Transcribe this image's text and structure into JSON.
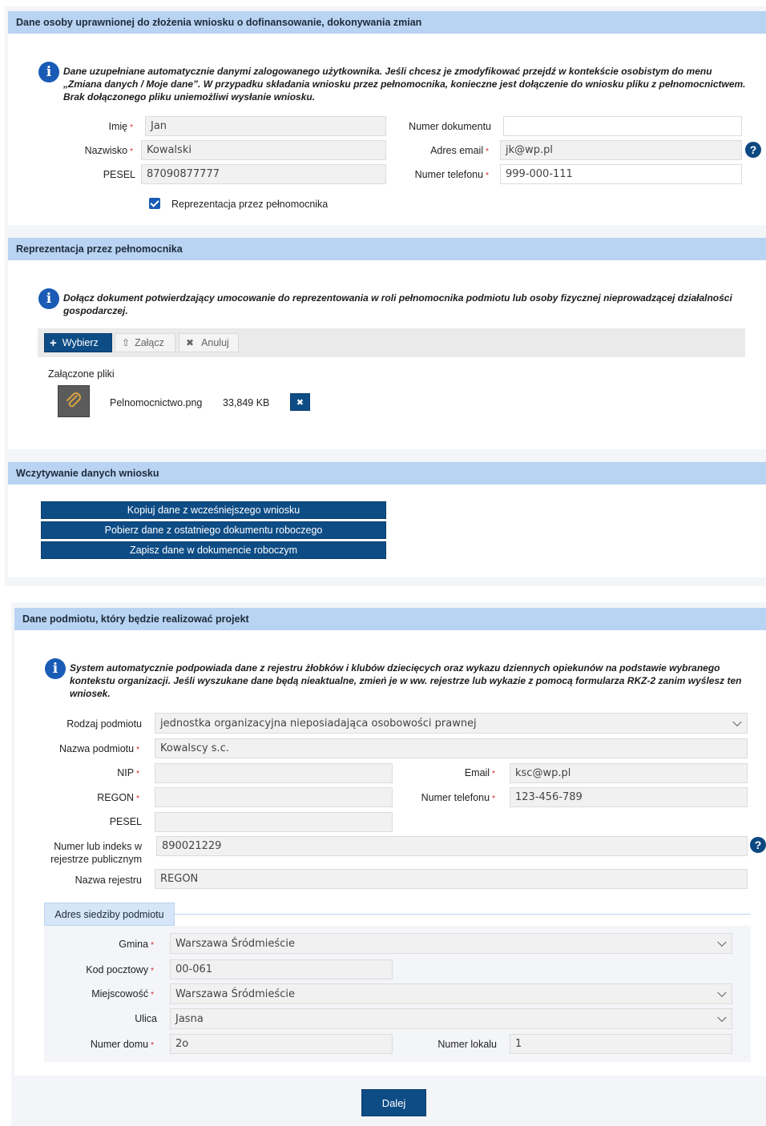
{
  "section1": {
    "title": "Dane osoby uprawnionej do złożenia wniosku o dofinansowanie, dokonywania zmian",
    "info": "Dane uzupełniane automatycznie danymi zalogowanego użytkownika. Jeśli chcesz je zmodyfikować przejdź w kontekście osobistym do menu „Zmiana danych / Moje dane”. W przypadku składania wniosku przez pełnomocnika, konieczne jest dołączenie do wniosku pliku z pełnomocnictwem. Brak dołączonego pliku uniemożliwi wysłanie wniosku.",
    "fields": {
      "imie_label": "Imię",
      "imie_value": "Jan",
      "nazwisko_label": "Nazwisko",
      "nazwisko_value": "Kowalski",
      "pesel_label": "PESEL",
      "pesel_value": "87090877777",
      "numer_dokumentu_label": "Numer dokumentu",
      "numer_dokumentu_value": "",
      "adres_email_label": "Adres email",
      "adres_email_value": "jk@wp.pl",
      "numer_telefonu_label": "Numer telefonu",
      "numer_telefonu_value": "999-000-111"
    },
    "checkbox_label": "Reprezentacja przez pełnomocnika"
  },
  "section2": {
    "title": "Reprezentacja przez pełnomocnika",
    "info": "Dołącz dokument potwierdzający umocowanie do reprezentowania w roli pełnomocnika podmiotu lub osoby fizycznej nieprowadzącej działalności gospodarczej.",
    "buttons": {
      "wybierz": "Wybierz",
      "zalacz": "Załącz",
      "anuluj": "Anuluj"
    },
    "attached_label": "Załączone pliki",
    "file": {
      "name": "Pelnomocnictwo.png",
      "size": "33,849 KB"
    }
  },
  "section3": {
    "title": "Wczytywanie danych wniosku",
    "buttons": {
      "kopiuj": "Kopiuj dane z wcześniejszego wniosku",
      "pobierz": "Pobierz dane z ostatniego dokumentu roboczego",
      "zapisz": "Zapisz dane w dokumencie roboczym"
    }
  },
  "section4": {
    "title": "Dane podmiotu, który będzie realizować projekt",
    "info": "System automatycznie podpowiada dane z rejestru żłobków i klubów dziecięcych oraz wykazu dziennych opiekunów na podstawie wybranego kontekstu organizacji. Jeśli wyszukane dane będą nieaktualne, zmień je w ww. rejestrze lub wykazie z pomocą formularza RKZ-2 zanim wyślesz ten wniosek.",
    "fields": {
      "rodzaj_label": "Rodzaj podmiotu",
      "rodzaj_value": "jednostka organizacyjna nieposiadająca osobowości prawnej",
      "nazwa_label": "Nazwa podmiotu",
      "nazwa_value": "Kowalscy s.c.",
      "nip_label": "NIP",
      "nip_value": "",
      "regon_label": "REGON",
      "regon_value": "",
      "pesel_label": "PESEL",
      "pesel_value": "",
      "email_label": "Email",
      "email_value": "ksc@wp.pl",
      "telefon_label": "Numer telefonu",
      "telefon_value": "123-456-789",
      "numer_rejestr_label_1": "Numer lub indeks w",
      "numer_rejestr_label_2": "rejestrze publicznym",
      "numer_rejestr_value": "890021229",
      "nazwa_rejestru_label": "Nazwa rejestru",
      "nazwa_rejestru_value": "REGON"
    },
    "address_tab": "Adres siedziby podmiotu",
    "address": {
      "gmina_label": "Gmina",
      "gmina_value": "Warszawa Śródmieście",
      "kod_label": "Kod pocztowy",
      "kod_value": "00-061",
      "miejscowosc_label": "Miejscowość",
      "miejscowosc_value": "Warszawa Śródmieście",
      "ulica_label": "Ulica",
      "ulica_value": "Jasna",
      "numer_domu_label": "Numer domu",
      "numer_domu_value": "2o",
      "numer_lokalu_label": "Numer lokalu",
      "numer_lokalu_value": "1"
    },
    "required_mark": "*"
  },
  "footer": {
    "next_button": "Dalej"
  },
  "icons": {
    "info": "info-icon",
    "help": "help-icon",
    "plus": "plus-icon",
    "upload": "upload-icon",
    "close": "close-icon",
    "paperclip": "paperclip-icon"
  },
  "colors": {
    "header_bg": "#b9d3f2",
    "navy": "#0e4c85",
    "info_blue": "#1a5bb5",
    "required": "#d9232e"
  }
}
